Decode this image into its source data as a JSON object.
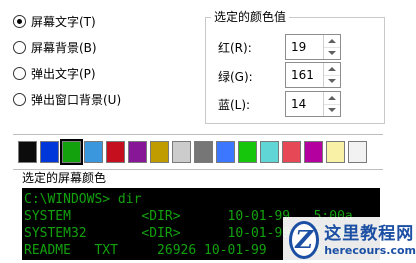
{
  "radio_options": [
    {
      "label": "屏幕文字(T)",
      "checked": true
    },
    {
      "label": "屏幕背景(B)",
      "checked": false
    },
    {
      "label": "弹出文字(P)",
      "checked": false
    },
    {
      "label": "弹出窗口背景(U)",
      "checked": false
    }
  ],
  "selected_color": {
    "title": "选定的颜色值",
    "red": {
      "label": "红(R):",
      "value": "19"
    },
    "green": {
      "label": "绿(G):",
      "value": "161"
    },
    "blue": {
      "label": "蓝(L):",
      "value": "14"
    }
  },
  "palette": {
    "colors": [
      "#0c0c0c",
      "#0037da",
      "#13a10e",
      "#3a96dd",
      "#c50f1f",
      "#881798",
      "#c19c00",
      "#cccccc",
      "#767676",
      "#3b78ff",
      "#16c60c",
      "#61d6d6",
      "#e74856",
      "#b4009e",
      "#f9f1a5",
      "#f2f2f2"
    ],
    "selected_index": 2
  },
  "preview": {
    "title": "选定的屏幕颜色",
    "text_color": "#13a10e",
    "background": "#000000",
    "lines": [
      "C:\\WINDOWS> dir",
      "SYSTEM         <DIR>      10-01-99   5:00a",
      "SYSTEM32       <DIR>      10-01-99   5:00a",
      "README   TXT     26926 10-01-99   5:00a"
    ]
  },
  "watermark": {
    "logo_letter": "Z",
    "name": "这里教程网",
    "url": "herecours.com"
  }
}
